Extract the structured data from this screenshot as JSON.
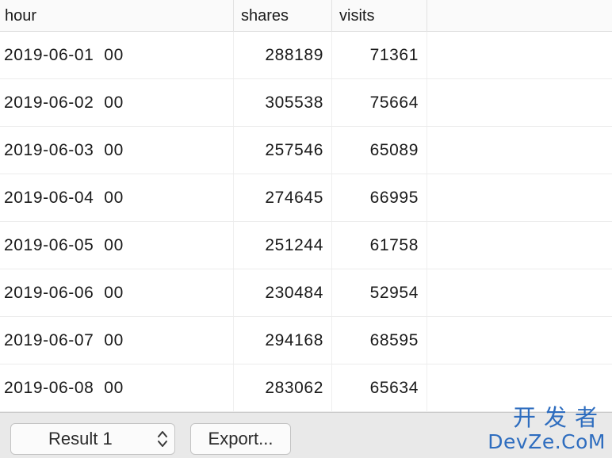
{
  "table": {
    "columns": [
      "hour",
      "shares",
      "visits"
    ],
    "rows": [
      {
        "hour": "2019-06-01  00",
        "shares": "288189",
        "visits": "71361"
      },
      {
        "hour": "2019-06-02  00",
        "shares": "305538",
        "visits": "75664"
      },
      {
        "hour": "2019-06-03  00",
        "shares": "257546",
        "visits": "65089"
      },
      {
        "hour": "2019-06-04  00",
        "shares": "274645",
        "visits": "66995"
      },
      {
        "hour": "2019-06-05  00",
        "shares": "251244",
        "visits": "61758"
      },
      {
        "hour": "2019-06-06  00",
        "shares": "230484",
        "visits": "52954"
      },
      {
        "hour": "2019-06-07  00",
        "shares": "294168",
        "visits": "68595"
      },
      {
        "hour": "2019-06-08  00",
        "shares": "283062",
        "visits": "65634"
      }
    ]
  },
  "footer": {
    "result_select_value": "Result 1",
    "export_label": "Export...",
    "stepper_icon": "up-down-chevron-icon"
  },
  "watermark": {
    "line1": "开发者",
    "line2": "DevZe.CoM",
    "color": "#2e6dbf"
  }
}
